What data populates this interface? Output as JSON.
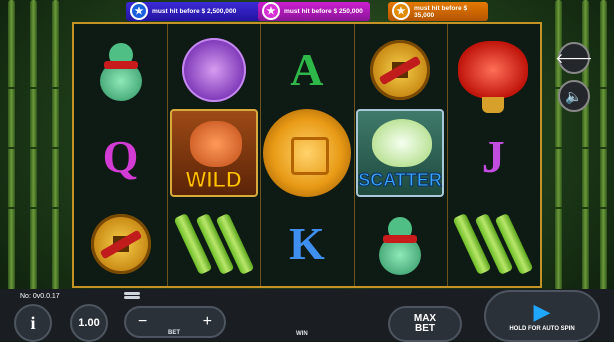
{
  "jackpots": [
    {
      "label": "must hit before $ 2,500,000",
      "star": "★"
    },
    {
      "label": "must hit before $ 250,000",
      "star": "★"
    },
    {
      "label": "must hit before $ 35,000",
      "star": "★"
    }
  ],
  "reels": {
    "symbols": [
      [
        "gourd",
        "letter-Q",
        "cash-coin"
      ],
      [
        "koi-fish",
        "wild-red-panda",
        "bamboo"
      ],
      [
        "letter-A",
        "golden-gong",
        "letter-K"
      ],
      [
        "cash-coin",
        "scatter-lotus",
        "gourd"
      ],
      [
        "red-lantern",
        "letter-J",
        "bamboo"
      ]
    ],
    "letters": {
      "q": "Q",
      "a": "A",
      "k": "K",
      "j": "J"
    },
    "wild_text": "WILD",
    "scatter_text": "SCATTER"
  },
  "side": {
    "back_icon": "🡐",
    "mute_icon": "🔈"
  },
  "bottom": {
    "version": "No: 0v0.0.17",
    "info_label": "i",
    "bet_value": "1.00",
    "bet_label": "BET",
    "minus": "−",
    "plus": "+",
    "win_label": "WIN",
    "maxbet_line1": "MAX",
    "maxbet_line2": "BET",
    "spin_label": "HOLD FOR AUTO SPIN",
    "spin_icon": "▶"
  },
  "colors": {
    "q": "#d23bd4",
    "a": "#2fb84a",
    "k": "#3e8ff0",
    "j": "#c34ce0",
    "spin": "#1fa7ff"
  }
}
